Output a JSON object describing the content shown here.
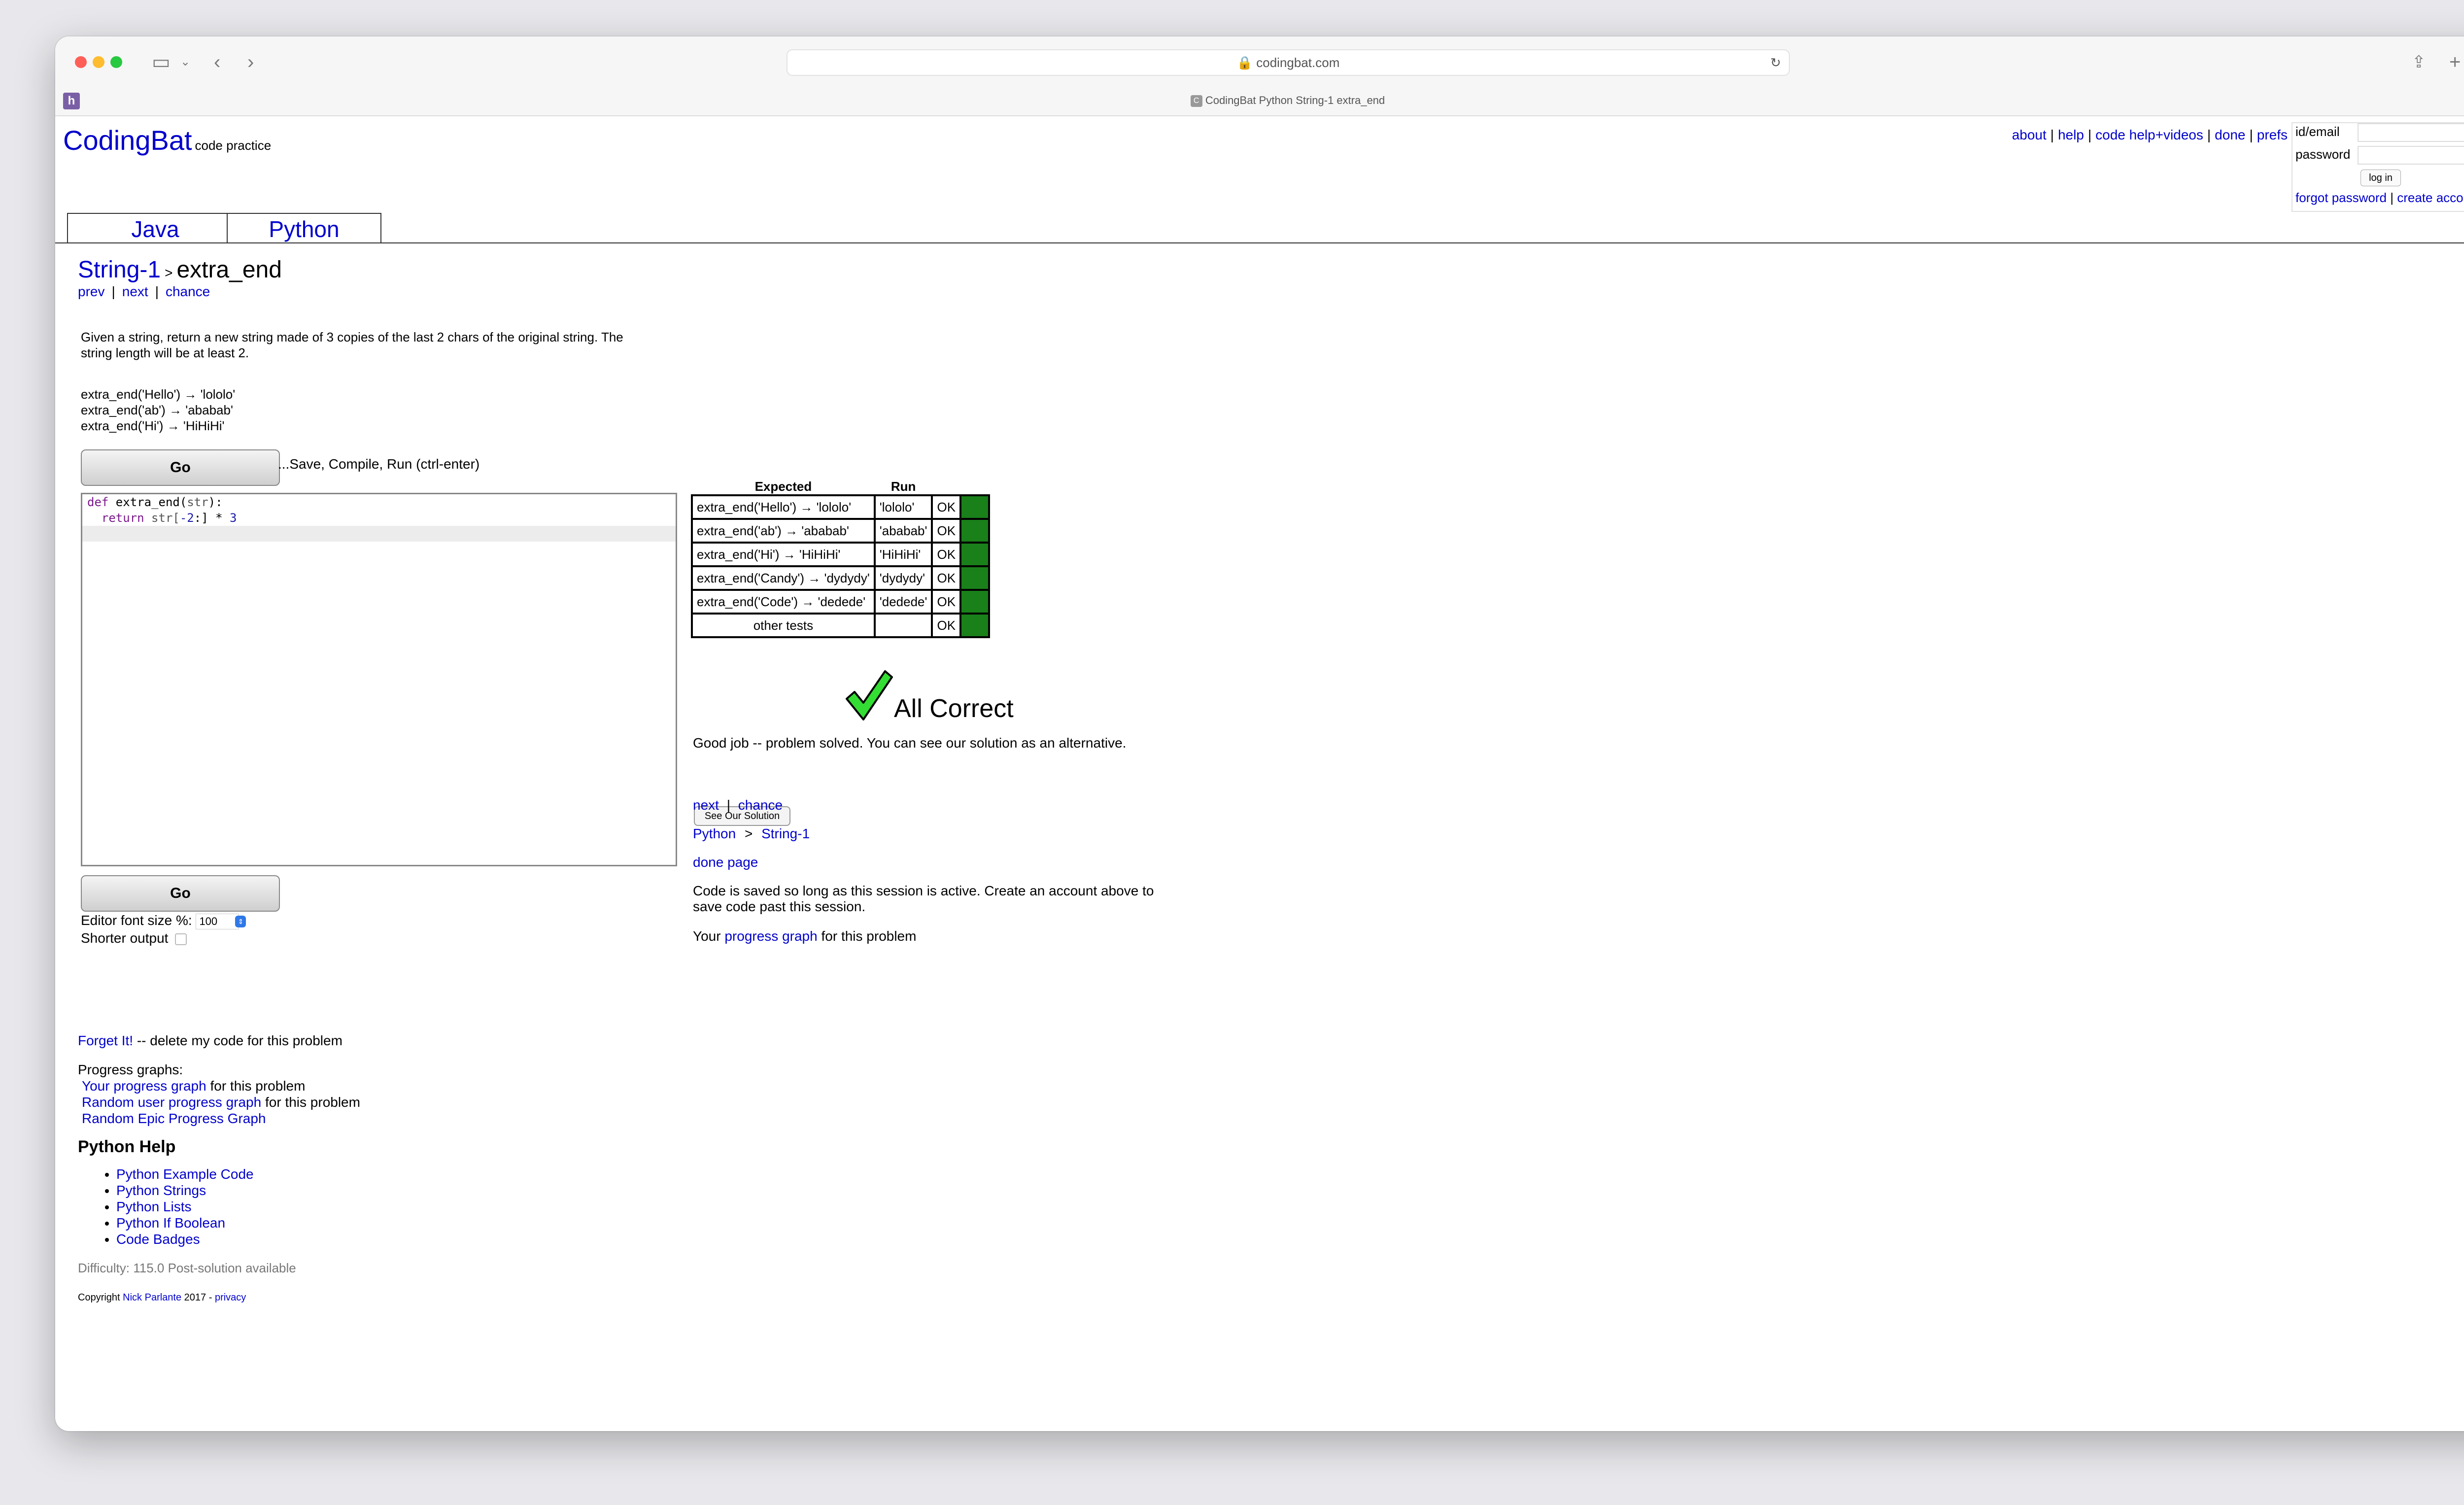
{
  "browser": {
    "url": "codingbat.com",
    "tab_title": "CodingBat Python String-1 extra_end",
    "favicon_letter": "h"
  },
  "header": {
    "logo": "CodingBat",
    "logo_sub": "code practice",
    "links": [
      "about",
      "help",
      "code help+videos",
      "done",
      "prefs"
    ],
    "sep": "|"
  },
  "login": {
    "id_label": "id/email",
    "password_label": "password",
    "login_button": "log in",
    "forgot": "forgot password",
    "create": "create account"
  },
  "tabs": [
    "Java",
    "Python"
  ],
  "problem": {
    "category": "String-1",
    "arrow": ">",
    "name": "extra_end",
    "nav": [
      "prev",
      "next",
      "chance"
    ],
    "description": "Given a string, return a new string made of 3 copies of the last 2 chars of the original string. The string length will be at least 2.",
    "examples": [
      "extra_end('Hello') → 'lololo'",
      "extra_end('ab') → 'ababab'",
      "extra_end('Hi') → 'HiHiHi'"
    ]
  },
  "editor": {
    "go_label": "Go",
    "go_hint": "...Save, Compile, Run (ctrl-enter)",
    "code_line1_kw": "def",
    "code_line1_fn": " extra_end(",
    "code_line1_param": "str",
    "code_line1_end": "):",
    "code_line2_kw": "  return",
    "code_line2_rest": " str[",
    "code_line2_num1": "-2",
    "code_line2_mid": ":] * ",
    "code_line2_num2": "3",
    "font_label": "Editor font size %:",
    "font_value": "100",
    "shorter_label": "Shorter output"
  },
  "results": {
    "headers": [
      "Expected",
      "Run"
    ],
    "rows": [
      {
        "expected": "extra_end('Hello') → 'lololo'",
        "run": "'lololo'",
        "status": "OK"
      },
      {
        "expected": "extra_end('ab') → 'ababab'",
        "run": "'ababab'",
        "status": "OK"
      },
      {
        "expected": "extra_end('Hi') → 'HiHiHi'",
        "run": "'HiHiHi'",
        "status": "OK"
      },
      {
        "expected": "extra_end('Candy') → 'dydydy'",
        "run": "'dydydy'",
        "status": "OK"
      },
      {
        "expected": "extra_end('Code') → 'dedede'",
        "run": "'dedede'",
        "status": "OK"
      },
      {
        "expected": "other tests",
        "run": "",
        "status": "OK"
      }
    ],
    "pass_color": "#1a801a",
    "all_correct": "All Correct",
    "good_job": "Good job -- problem solved. You can see our solution as an alternative.",
    "see_solution": "See Our Solution",
    "next": "next",
    "chance": "chance",
    "bc_python": "Python",
    "bc_gt": ">",
    "bc_string1": "String-1",
    "done_page": "done page",
    "saved_note": "Code is saved so long as this session is active. Create an account above to save code past this session.",
    "your": "Your",
    "progress_graph": "progress graph",
    "for_problem": "for this problem"
  },
  "sidebar": {
    "forget_link": "Forget It!",
    "forget_rest": "-- delete my code for this problem",
    "progress_title": "Progress graphs:",
    "pg1_link": "Your progress graph",
    "pg1_rest": "for this problem",
    "pg2_link": "Random user progress graph",
    "pg2_rest": "for this problem",
    "pg3_link": "Random Epic Progress Graph",
    "help_title": "Python Help",
    "help_links": [
      "Python Example Code",
      "Python Strings",
      "Python Lists",
      "Python If Boolean",
      "Code Badges"
    ],
    "difficulty": "Difficulty: 115.0 Post-solution available",
    "copyright_pre": "Copyright",
    "copyright_name": "Nick Parlante",
    "copyright_year": "2017 -",
    "privacy": "privacy"
  }
}
